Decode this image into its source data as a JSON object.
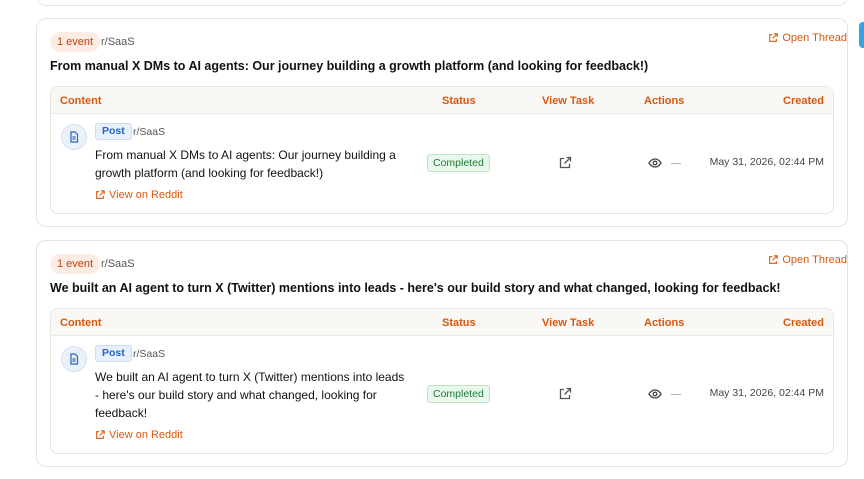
{
  "threads": [
    {
      "badge": "1 event",
      "subreddit": "r/SaaS",
      "open_thread": "Open Thread",
      "title": "From manual X DMs to AI agents: Our journey building a growth platform (and looking for feedback!)",
      "columns": {
        "content": "Content",
        "status": "Status",
        "view_task": "View Task",
        "actions": "Actions",
        "created": "Created"
      },
      "row": {
        "type": "Post",
        "subreddit": "r/SaaS",
        "title": "From manual X DMs to AI agents: Our journey building a growth platform (and looking for feedback!)",
        "link": "View on Reddit",
        "status": "Completed",
        "action_secondary": "—",
        "created": "May 31, 2026, 02:44 PM"
      }
    },
    {
      "badge": "1 event",
      "subreddit": "r/SaaS",
      "open_thread": "Open Thread",
      "title": "We built an AI agent to turn X (Twitter) mentions into leads - here's our build story and what changed, looking for feedback!",
      "columns": {
        "content": "Content",
        "status": "Status",
        "view_task": "View Task",
        "actions": "Actions",
        "created": "Created"
      },
      "row": {
        "type": "Post",
        "subreddit": "r/SaaS",
        "title": "We built an AI agent to turn X (Twitter) mentions into leads - here's our build story and what changed, looking for feedback!",
        "link": "View on Reddit",
        "status": "Completed",
        "action_secondary": "—",
        "created": "May 31, 2026, 02:44 PM"
      }
    }
  ],
  "icons": {
    "open_thread": "external-link-icon",
    "doc": "document-icon",
    "view_task": "external-link-icon",
    "action": "eye-icon"
  },
  "colors": {
    "accent": "#d9570f",
    "status_completed": "#1c7c34",
    "post_tag": "#2463c7"
  }
}
